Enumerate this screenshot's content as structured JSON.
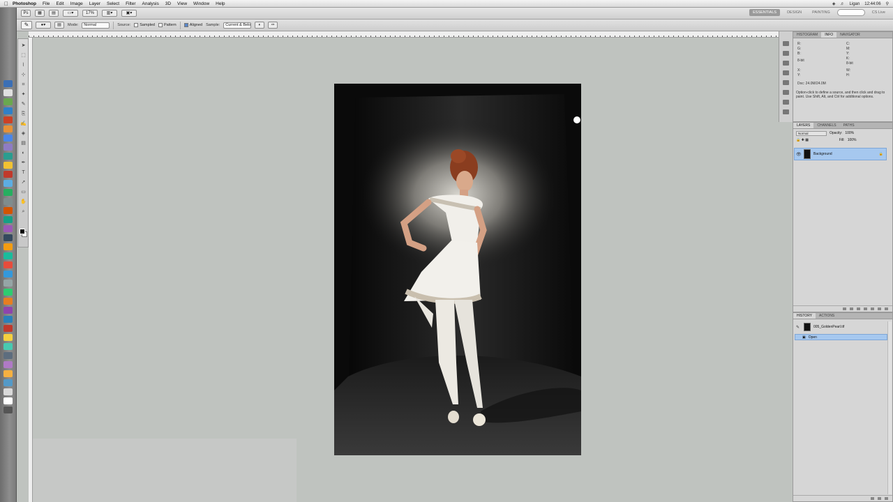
{
  "menubar": {
    "apple_icon": "apple-icon",
    "app_name": "Photoshop",
    "items": [
      "File",
      "Edit",
      "Image",
      "Layer",
      "Select",
      "Filter",
      "Analysis",
      "3D",
      "View",
      "Window",
      "Help"
    ],
    "clock": "12:44:06",
    "user": "Ligan"
  },
  "appbar": {
    "zoom": "17%",
    "workspaces": [
      "ESSENTIALS",
      "DESIGN",
      "PAINTING"
    ],
    "active_workspace": "ESSENTIALS",
    "cs_live": "CS Live"
  },
  "options": {
    "mode_label": "Mode:",
    "mode_value": "Normal",
    "source_label": "Source:",
    "source_sampled": "Sampled",
    "source_pattern": "Pattern",
    "aligned_label": "Aligned",
    "sample_label": "Sample:",
    "sample_value": "Current & Below"
  },
  "info_panel": {
    "tabs": [
      "HISTOGRAM",
      "INFO",
      "NAVIGATOR"
    ],
    "active_tab": "INFO",
    "rows": [
      "R:",
      "G:",
      "B:",
      "8-bit",
      "C:",
      "M:",
      "Y:",
      "K:",
      "8-bit",
      "X:",
      "Y:",
      "W:",
      "H:",
      "Doc: 24.0M/24.0M"
    ],
    "description": "Option-click to define a source, and then click and drag to paint. Use Shift, Alt, and Ctrl for additional options."
  },
  "layers_panel": {
    "tabs": [
      "LAYERS",
      "CHANNELS",
      "PATHS"
    ],
    "active_tab": "LAYERS",
    "blend_mode": "Normal",
    "opacity_label": "Opacity:",
    "opacity": "100%",
    "fill_label": "Fill:",
    "fill": "100%",
    "layers": [
      {
        "name": "Background"
      }
    ]
  },
  "history_panel": {
    "tabs": [
      "HISTORY",
      "ACTIONS"
    ],
    "active_tab": "HISTORY",
    "snapshot_name": "005_GoldenPearl.tif",
    "states": [
      "Open"
    ]
  },
  "colors": {
    "selection": "#a6c8ef",
    "workspace_bg": "#bfc3bf",
    "foreground": "#000000",
    "background": "#ffffff"
  },
  "icons": {
    "active_tool": "clone-stamp-icon",
    "spot_light": "light-spot-icon"
  }
}
